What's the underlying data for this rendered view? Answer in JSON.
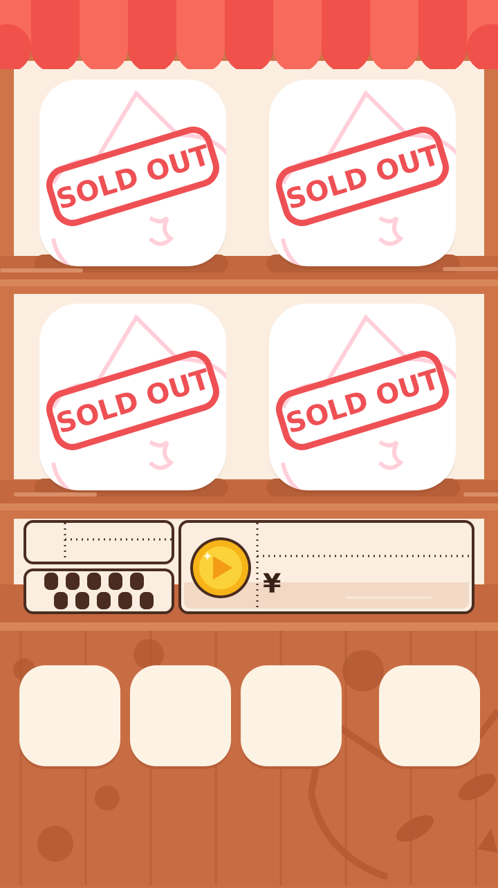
{
  "shop": {
    "items": [
      {
        "stamp": "SOLD OUT"
      },
      {
        "stamp": "SOLD OUT"
      },
      {
        "stamp": "SOLD OUT"
      },
      {
        "stamp": "SOLD OUT"
      }
    ]
  },
  "panel": {
    "currency_symbol": "¥",
    "video_coin_icon": "play-coin-icon",
    "dots_count": 10
  },
  "cards": [
    {
      "label": ""
    },
    {
      "label": ""
    },
    {
      "label": ""
    },
    {
      "label": ""
    }
  ],
  "colors": {
    "awning_red": "#f0514a",
    "awning_light": "#f86a5c",
    "shelf_wood": "#cf7448",
    "shelf_back": "#fbeee1",
    "stamp_red": "#ee5054",
    "cat_outline": "#ffd0da",
    "coin_gold": "#f7b418",
    "panel_border": "#4a2c20"
  }
}
